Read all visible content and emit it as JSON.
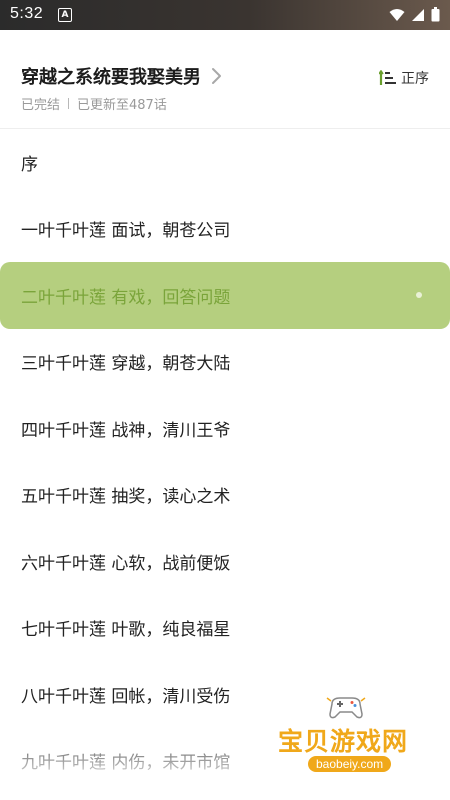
{
  "status_bar": {
    "time": "5:32",
    "app_icon_letter": "A",
    "icons": [
      "wifi-icon",
      "signal-icon",
      "battery-icon"
    ]
  },
  "header": {
    "book_title": "穿越之系统要我娶美男",
    "status": "已完结",
    "update_info": "已更新至487话",
    "sort_label": "正序"
  },
  "chapters": [
    {
      "title": "序",
      "active": false
    },
    {
      "title": "一叶千叶莲 面试，朝苍公司",
      "active": false
    },
    {
      "title": "二叶千叶莲 有戏，回答问题",
      "active": true
    },
    {
      "title": "三叶千叶莲 穿越，朝苍大陆",
      "active": false
    },
    {
      "title": "四叶千叶莲 战神，清川王爷",
      "active": false
    },
    {
      "title": "五叶千叶莲 抽奖，读心之术",
      "active": false
    },
    {
      "title": "六叶千叶莲 心软，战前便饭",
      "active": false
    },
    {
      "title": "七叶千叶莲 叶歌，纯良福星",
      "active": false
    },
    {
      "title": "八叶千叶莲 回帐，清川受伤",
      "active": false
    },
    {
      "title": "九叶千叶莲 内伤，未开市馆",
      "active": false
    }
  ],
  "watermark": {
    "text": "宝贝游戏网",
    "url": "baobeiy.com"
  },
  "colors": {
    "active_row_bg": "#b5cf7f",
    "active_row_text": "#7aa43a",
    "sort_icon_accent": "#6a9f2e",
    "watermark": "#f0a81a"
  }
}
